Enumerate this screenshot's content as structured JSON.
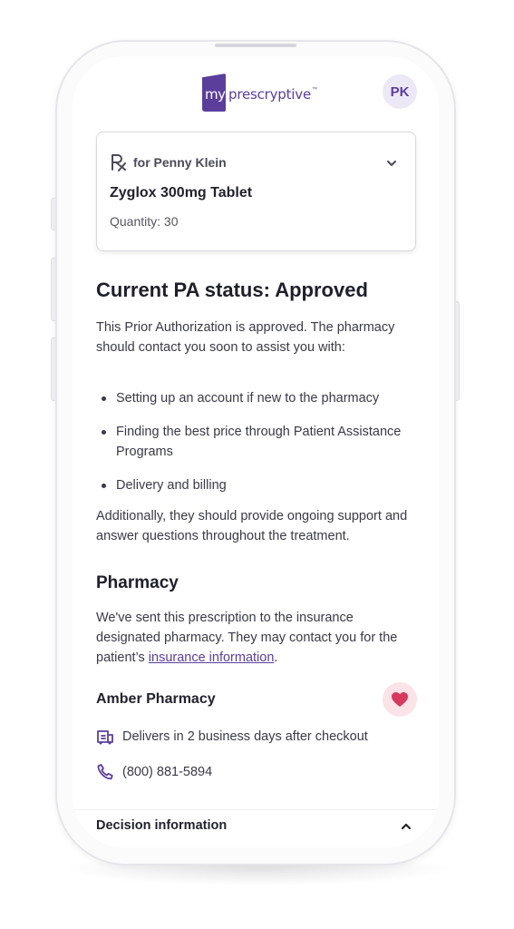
{
  "header": {
    "logo_my": "my",
    "logo_brand": "prescryptive",
    "logo_tm": "™",
    "avatar_initials": "PK"
  },
  "prescription_card": {
    "for_label": "for Penny Klein",
    "drug_name": "Zyglox 300mg Tablet",
    "quantity": "Quantity: 30"
  },
  "status": {
    "title": "Current PA status: Approved",
    "intro": "This Prior Authorization is approved. The pharmacy should contact you soon to assist you with:",
    "bullets": [
      "Setting up an account if new to the pharmacy",
      "Finding the best price through Patient Assistance Programs",
      "Delivery and billing"
    ],
    "additional": "Additionally, they should provide ongoing support and answer questions throughout the treatment."
  },
  "pharmacy": {
    "heading": "Pharmacy",
    "text_before_link": "We've sent this prescription to the insurance designated pharmacy. They may contact you for the patient’s ",
    "link_text": "insurance information",
    "text_after_link": ".",
    "name": "Amber Pharmacy",
    "delivery": "Delivers in 2 business days after checkout",
    "phone": "(800) 881-5894"
  },
  "decision": {
    "label": "Decision information"
  },
  "colors": {
    "brand_purple": "#5b3e9b",
    "heart_red": "#d63a5e",
    "heart_bg": "#fbe3e8",
    "avatar_bg": "#ede8f6"
  },
  "icons": [
    "rx-icon",
    "chevron-down-icon",
    "heart-icon",
    "delivery-truck-icon",
    "phone-icon",
    "chevron-up-icon"
  ]
}
